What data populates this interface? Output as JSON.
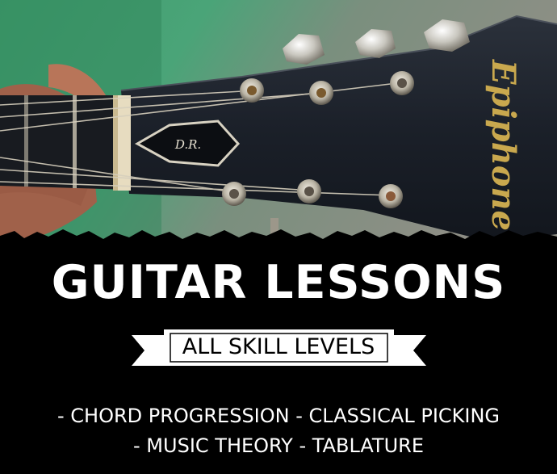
{
  "poster": {
    "title": "GUITAR LESSONS",
    "ribbon_text": "ALL SKILL LEVELS",
    "features_line1": "- CHORD PROGRESSION - CLASSICAL PICKING",
    "features_line2": "- MUSIC THEORY - TABLATURE",
    "headstock_monogram": "D.R.",
    "headstock_brand": "Epiphone"
  },
  "colors": {
    "background": "#000000",
    "text": "#ffffff",
    "ribbon": "#ffffff",
    "shirt_green": "#3d9a6a",
    "headstock": "#20252e"
  }
}
